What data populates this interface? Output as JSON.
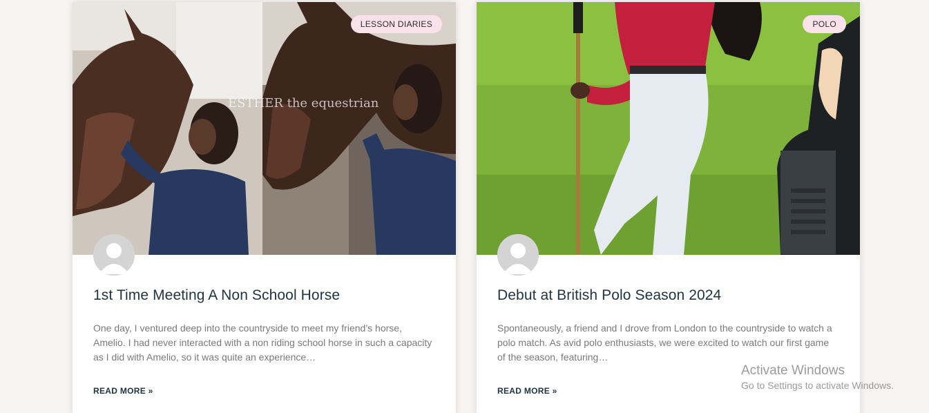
{
  "posts": [
    {
      "category": "LESSON DIARIES",
      "title": "1st Time Meeting A Non School Horse",
      "excerpt": "One day, I ventured deep into the countryside to meet my friend’s horse, Amelio. I had never interacted with a non riding school horse in such a capacity as I did with Amelio, so it was quite an experience…",
      "read_more": "READ MORE »",
      "image_watermark": "ESTHER the equestrian"
    },
    {
      "category": "POLO",
      "title": "Debut at British Polo Season 2024",
      "excerpt": "Spontaneously, a friend and I drove from London to the countryside to watch a polo match. As avid polo enthusiasts, we were excited to watch our first game of the season, featuring…",
      "read_more": "READ MORE »"
    }
  ],
  "os_watermark": {
    "line1": "Activate Windows",
    "line2": "Go to Settings to activate Windows."
  },
  "colors": {
    "page_bg": "#f8f4f1",
    "badge_bg": "#fbe2ea",
    "title": "#21343f",
    "excerpt": "#7a7a7a"
  }
}
